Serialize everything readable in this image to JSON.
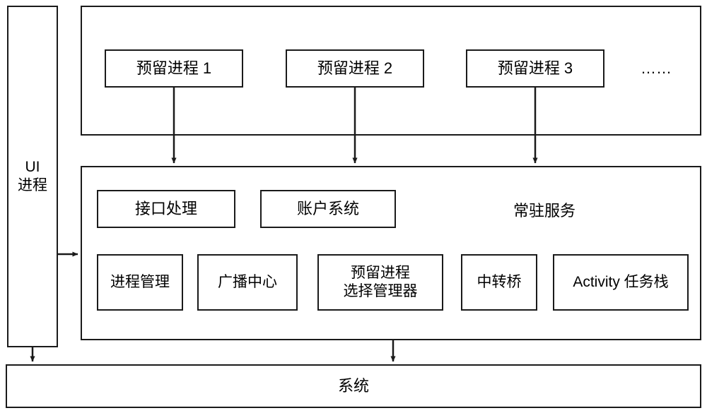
{
  "diagram": {
    "title": "",
    "ui_process": {
      "label": "UI\n进程"
    },
    "reserved_group": {
      "items": [
        {
          "label": "预留进程 1"
        },
        {
          "label": "预留进程 2"
        },
        {
          "label": "预留进程 3"
        }
      ],
      "ellipsis": "……"
    },
    "resident_service": {
      "label": "常驻服务",
      "row1": [
        {
          "label": "接口处理"
        },
        {
          "label": "账户系统"
        }
      ],
      "row2": [
        {
          "label": "进程管理"
        },
        {
          "label": "广播中心"
        },
        {
          "label": "预留进程\n选择管理器"
        },
        {
          "label": "中转桥"
        },
        {
          "label": "Activity 任务栈"
        }
      ]
    },
    "system": {
      "label": "系统"
    },
    "colors": {
      "stroke": "#1a1a1a",
      "background": "#ffffff"
    }
  }
}
